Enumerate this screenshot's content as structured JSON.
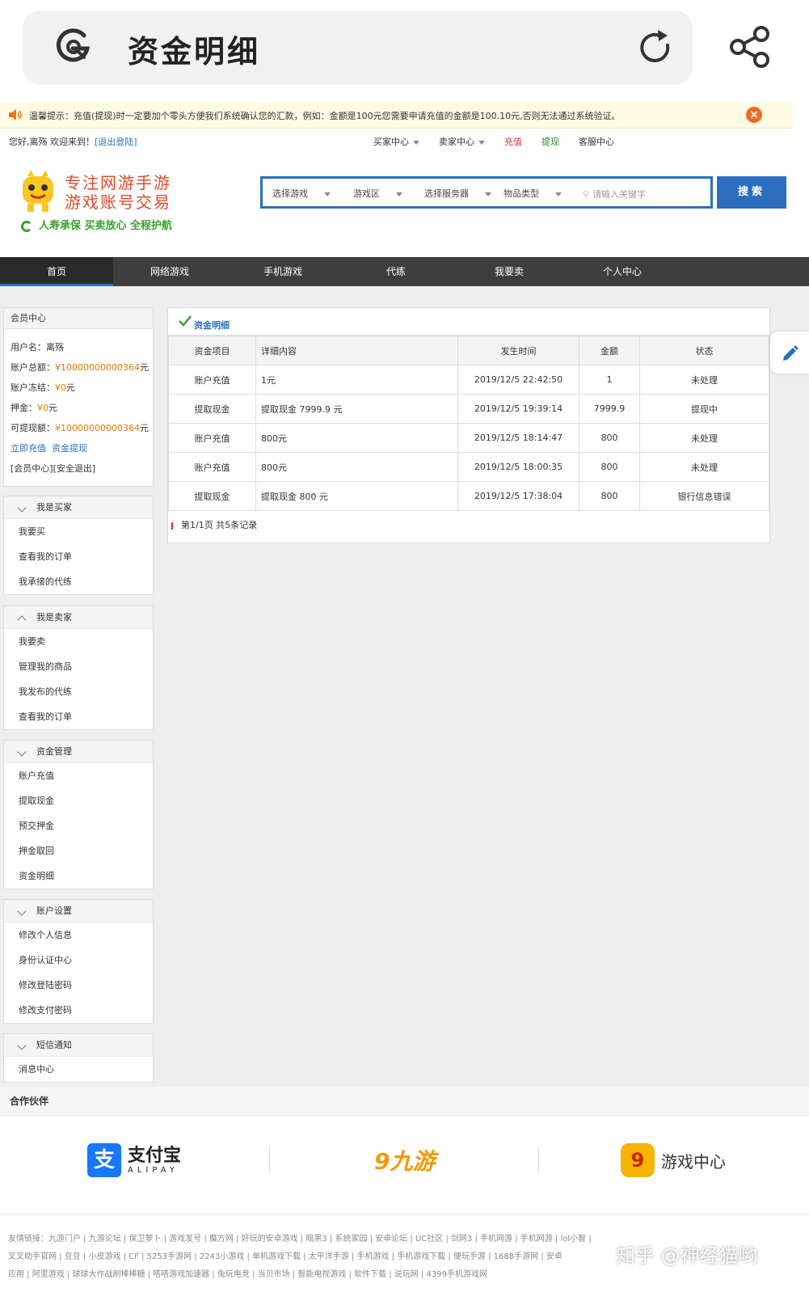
{
  "browser": {
    "title": "资金明细"
  },
  "notice": {
    "text": "温馨提示：充值(提现)时一定要加个零头方便我们系统确认您的汇款，例如：金额是100元您需要申请充值的金额是100.10元,否则无法通过系统验证。"
  },
  "userbar": {
    "welcome": "您好,离殇 欢迎来到！",
    "logout": "[退出登陆]",
    "links": [
      {
        "label": "买家中心",
        "dropdown": true
      },
      {
        "label": "卖家中心",
        "dropdown": true
      },
      {
        "label": "充值",
        "color": "red"
      },
      {
        "label": "提现",
        "color": "green"
      },
      {
        "label": "客服中心"
      }
    ]
  },
  "header": {
    "slogan_line1": "专注网游手游",
    "slogan_line2": "游戏账号交易",
    "slogan_line3": "人寿承保 买卖放心 全程护航",
    "search": {
      "selects": [
        "选择游戏",
        "游戏区",
        "选择服务器",
        "物品类型"
      ],
      "keyword_placeholder": "请输入关键字",
      "button": "搜索"
    }
  },
  "nav": {
    "items": [
      "首页",
      "网络游戏",
      "手机游戏",
      "代练",
      "我要卖",
      "个人中心"
    ],
    "active": "首页"
  },
  "member": {
    "title": "会员中心",
    "username_label": "用户名：",
    "username": "离殇",
    "balance_label": "账户总额：",
    "balance": "¥10000000000364",
    "frozen_label": "账户冻结：",
    "frozen": "¥0",
    "deposit_label": "押金：",
    "deposit": "¥0",
    "withdrawable_label": "可提现额：",
    "withdrawable": "¥10000000000364",
    "unit": "元",
    "recharge_link": "立即充值",
    "withdraw_link": "资金提现",
    "center_link": "[会员中心]",
    "safe_logout": "[安全退出]"
  },
  "groups": [
    {
      "title": "我是买家",
      "items": [
        "我要买",
        "查看我的订单",
        "我承接的代练"
      ]
    },
    {
      "title": "我是卖家",
      "items": [
        "我要卖",
        "管理我的商品",
        "我发布的代练",
        "查看我的订单"
      ]
    },
    {
      "title": "资金管理",
      "items": [
        "账户充值",
        "提取现金",
        "预交押金",
        "押金取回",
        "资金明细"
      ]
    },
    {
      "title": "账户设置",
      "items": [
        "修改个人信息",
        "身份认证中心",
        "修改登陆密码",
        "修改支付密码"
      ]
    },
    {
      "title": "短信通知",
      "items": [
        "消息中心"
      ]
    }
  ],
  "panel": {
    "title": "资金明细",
    "columns": [
      "资金项目",
      "详细内容",
      "发生时间",
      "金额",
      "状态"
    ],
    "rows": [
      [
        "账户充值",
        "1元",
        "2019/12/5 22:42:50",
        "1",
        "未处理"
      ],
      [
        "提取现金",
        "提取现金 7999.9 元",
        "2019/12/5 19:39:14",
        "7999.9",
        "提现中"
      ],
      [
        "账户充值",
        "800元",
        "2019/12/5 18:14:47",
        "800",
        "未处理"
      ],
      [
        "账户充值",
        "800元",
        "2019/12/5 18:00:35",
        "800",
        "未处理"
      ],
      [
        "提取现金",
        "提取现金 800 元",
        "2019/12/5 17:38:04",
        "800",
        "银行信息错误"
      ]
    ],
    "pager": "第1/1页 共5条记录"
  },
  "partners": {
    "title": "合作伙伴",
    "alipay_cn": "支付宝",
    "alipay_en": "ALIPAY",
    "jiuyou": "九游",
    "gamecenter": "游戏中心"
  },
  "footer": {
    "line1": "友情链接：九游门户 | 九游论坛 | 保卫萝卜 | 游戏发号 | 魔方网 | 好玩的安卓游戏 | 暗黑3 | 系统家园 | 安卓论坛 | UC社区 | 剑网3 | 手机网游 | 手机网游 | lol小智 |",
    "line2": "叉叉助手官网 | 豆豆 | 小皮游戏 | CF | 5253手游网 | 2243小游戏 | 单机游戏下载 | 太平洋手游 | 手机游戏 | 手机游戏下载 | 便玩手游 | 1688手游网 | 安卓",
    "line3": "应用 | 阿里游戏 | 球球大作战刷棒棒糖 | 嗒嗒游戏加速器 | 兔玩电竞 | 当贝市场 | 智能电视游戏 | 软件下载 | 说玩网 | 4399手机游戏网"
  },
  "watermark": "知乎 @神经猫哟"
}
